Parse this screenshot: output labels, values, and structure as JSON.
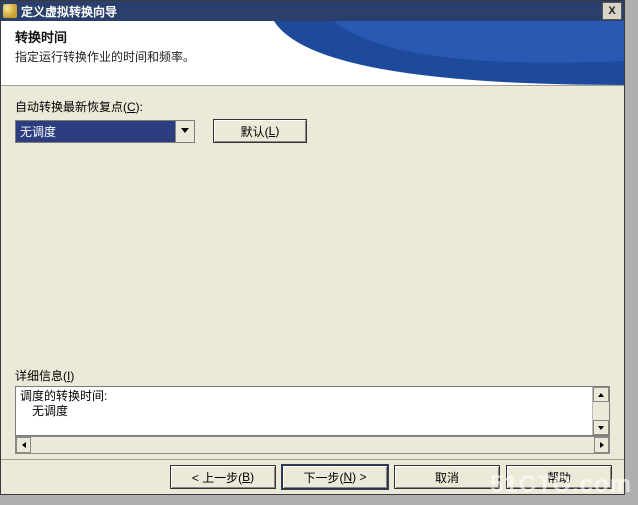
{
  "titlebar": {
    "text": "定义虚拟转换向导",
    "close": "X"
  },
  "header": {
    "title": "转换时间",
    "subtitle": "指定运行转换作业的时间和频率。"
  },
  "main": {
    "autoconvert_label_pre": "自动转换最新恢复点(",
    "autoconvert_key": "C",
    "autoconvert_label_post": "):",
    "combo_value": "无调度",
    "default_btn_pre": "默认(",
    "default_btn_key": "L",
    "default_btn_post": ")",
    "details_label_pre": "详细信息(",
    "details_key": "I",
    "details_label_post": ")",
    "details_line1": "调度的转换时间:",
    "details_line2": "无调度"
  },
  "buttons": {
    "back_pre": "< 上一步(",
    "back_key": "B",
    "back_post": ")",
    "next_pre": "下一步(",
    "next_key": "N",
    "next_post": ") >",
    "cancel": "取消",
    "help": "帮助"
  },
  "watermark": "51CTO.com"
}
